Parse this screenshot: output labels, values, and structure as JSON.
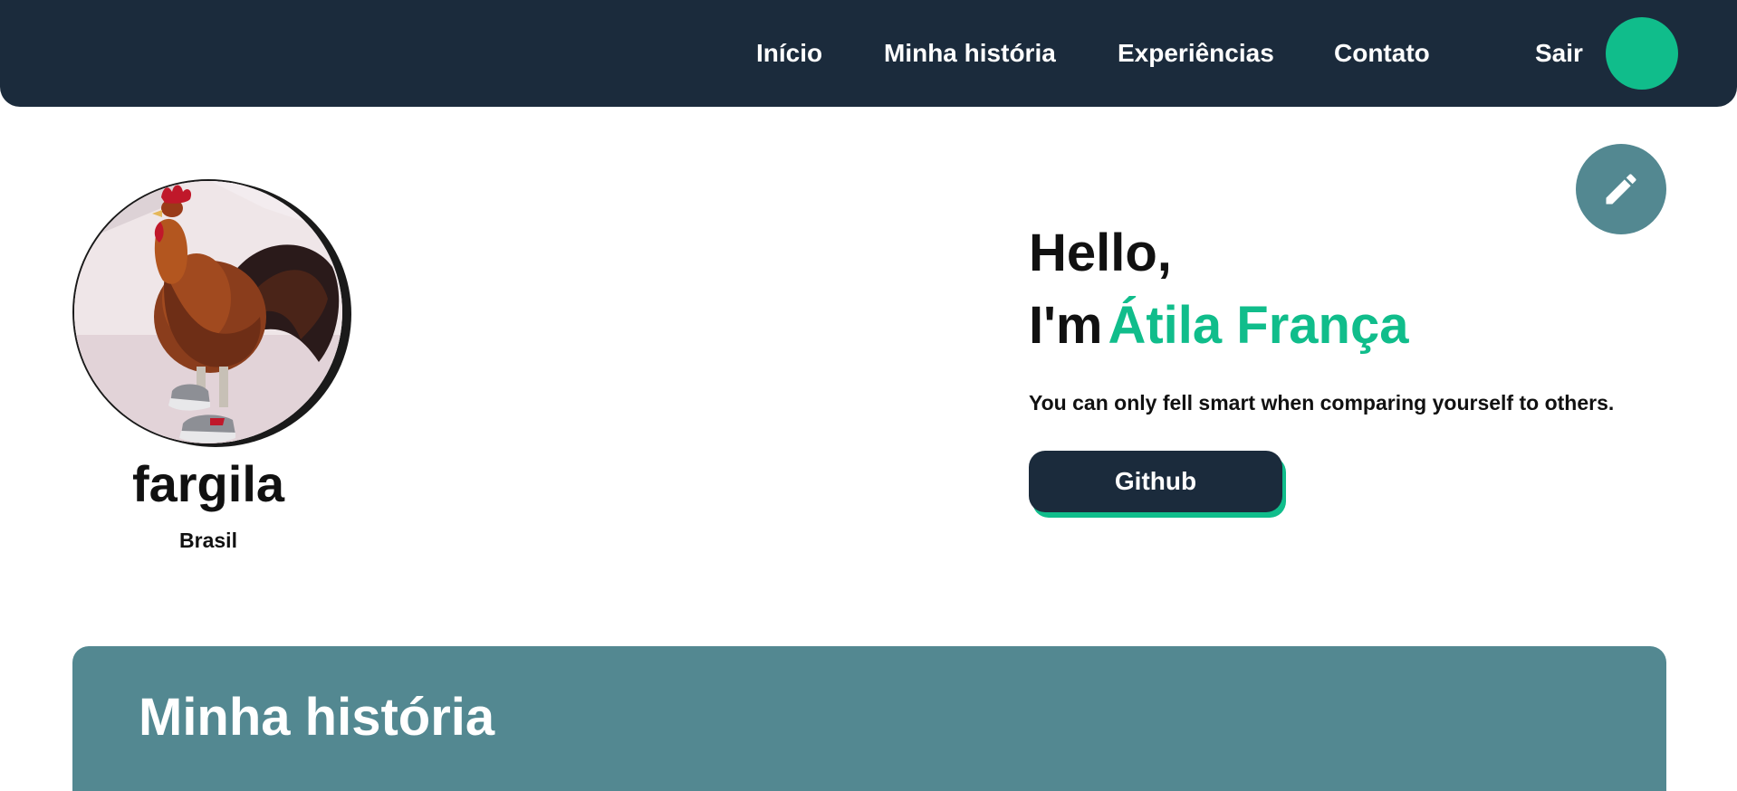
{
  "colors": {
    "navbar_bg": "#1b2b3c",
    "accent_green": "#10bd8b",
    "teal": "#538891",
    "text_dark": "#111111",
    "white": "#ffffff"
  },
  "nav": {
    "links": [
      {
        "label": "Início"
      },
      {
        "label": "Minha história"
      },
      {
        "label": "Experiências"
      },
      {
        "label": "Contato"
      }
    ],
    "logout_label": "Sair",
    "avatar_icon": "user-avatar-circle"
  },
  "profile": {
    "photo_icon": "rooster-in-sneakers-photo",
    "username": "fargila",
    "country": "Brasil"
  },
  "hero": {
    "greeting_line1": "Hello,",
    "greeting_prefix": "I'm",
    "name": "Átila França",
    "tagline": "You can only fell smart when comparing yourself to others.",
    "github_label": "Github"
  },
  "edit": {
    "icon": "pencil-icon"
  },
  "history": {
    "title": "Minha história"
  }
}
